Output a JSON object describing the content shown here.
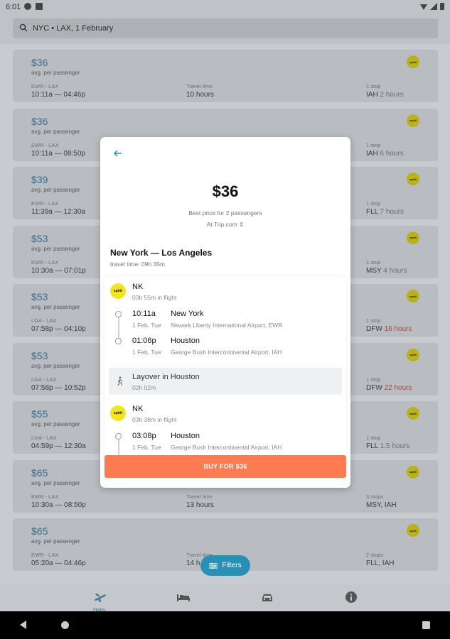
{
  "status_bar": {
    "time": "6:01"
  },
  "search": {
    "query": "NYC • LAX, 1 February"
  },
  "flights": [
    {
      "price": "$36",
      "avg": "avg. per passenger",
      "route": "EWR - LAX",
      "times": "10:11a — 04:46p",
      "travel_label": "Travel time",
      "travel_time": "10 hours",
      "stops_label": "1 stop",
      "stops_airport": "IAH",
      "stops_duration": "2 hours",
      "long_layover": false,
      "airline_logo": "spirit"
    },
    {
      "price": "$36",
      "avg": "avg. per passenger",
      "route": "EWR - LAX",
      "times": "10:11a — 08:50p",
      "travel_label": "",
      "travel_time": "",
      "stops_label": "1 stop",
      "stops_airport": "IAH",
      "stops_duration": "6 hours",
      "long_layover": false,
      "airline_logo": "spirit"
    },
    {
      "price": "$39",
      "avg": "avg. per passenger",
      "route": "EWR - LAX",
      "times": "11:39a — 12:30a",
      "travel_label": "",
      "travel_time": "",
      "stops_label": "1 stop",
      "stops_airport": "FLL",
      "stops_duration": "7 hours",
      "long_layover": false,
      "airline_logo": "spirit"
    },
    {
      "price": "$53",
      "avg": "avg. per passenger",
      "route": "EWR - LAX",
      "times": "10:30a — 07:01p",
      "travel_label": "",
      "travel_time": "",
      "stops_label": "1 stop",
      "stops_airport": "MSY",
      "stops_duration": "4 hours",
      "long_layover": false,
      "airline_logo": "spirit"
    },
    {
      "price": "$53",
      "avg": "avg. per passenger",
      "route": "LGA - LAX",
      "times": "07:58p — 04:10p",
      "travel_label": "",
      "travel_time": "",
      "stops_label": "1 stop",
      "stops_airport": "DFW",
      "stops_duration": "16 hours",
      "long_layover": true,
      "airline_logo": "spirit"
    },
    {
      "price": "$53",
      "avg": "avg. per passenger",
      "route": "LGA - LAX",
      "times": "07:58p — 10:52p",
      "travel_label": "",
      "travel_time": "",
      "stops_label": "1 stop",
      "stops_airport": "DFW",
      "stops_duration": "22 hours",
      "long_layover": true,
      "airline_logo": "spirit"
    },
    {
      "price": "$55",
      "avg": "avg. per passenger",
      "route": "LGA - LAX",
      "times": "04:59p — 12:30a",
      "travel_label": "",
      "travel_time": "",
      "stops_label": "1 stop",
      "stops_airport": "FLL",
      "stops_duration": "1.5 hours",
      "long_layover": false,
      "airline_logo": "spirit"
    },
    {
      "price": "$65",
      "avg": "avg. per passenger",
      "route": "EWR - LAX",
      "times": "10:30a — 08:50p",
      "travel_label": "Travel time",
      "travel_time": "13 hours",
      "stops_label": "3 stops",
      "stops_airport": "MSY, IAH",
      "stops_duration": "",
      "long_layover": false,
      "airline_logo": "spirit"
    },
    {
      "price": "$65",
      "avg": "avg. per passenger",
      "route": "EWR - LAX",
      "times": "05:20a — 04:46p",
      "travel_label": "Travel time",
      "travel_time": "14 h",
      "stops_label": "2 stops",
      "stops_airport": "FLL, IAH",
      "stops_duration": "",
      "long_layover": false,
      "airline_logo": "spirit"
    }
  ],
  "modal": {
    "price": "$36",
    "best_price": "Best price for 2 passengers",
    "at": "At Trip.com",
    "route_title": "New York — Los Angeles",
    "travel_time": "travel time: 09h 35m",
    "segments": [
      {
        "carrier": "NK",
        "flight_time": "03h 55m in flight",
        "logo": "spirit",
        "dep_time": "10:11a",
        "dep_city": "New York",
        "dep_date": "1 Feb, Tue",
        "dep_airport": "Newark Liberty International Airport, EWR",
        "arr_time": "01:06p",
        "arr_city": "Houston",
        "arr_date": "1 Feb, Tue",
        "arr_airport": "George Bush Intercontinental Airport, IAH"
      },
      {
        "carrier": "NK",
        "flight_time": "03h 38m in flight",
        "logo": "spirit",
        "dep_time": "03:08p",
        "dep_city": "Houston",
        "dep_date": "1 Feb, Tue",
        "dep_airport": "George Bush Intercontinental Airport, IAH"
      }
    ],
    "layover": {
      "title": "Layover in Houston",
      "duration": "02h 02m"
    },
    "buy_label": "BUY FOR $36"
  },
  "fab": {
    "label": "Filters"
  },
  "bottom_nav": {
    "flights_label": "Flights"
  },
  "colors": {
    "accent": "#2a8fb5",
    "buy": "#ff7b52",
    "spirit": "#f2e41e",
    "warning": "#a24a48"
  }
}
